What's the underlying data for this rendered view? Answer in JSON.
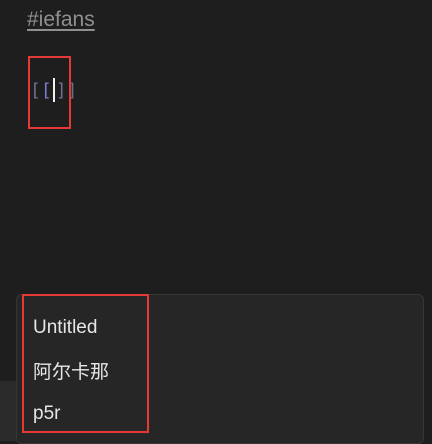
{
  "editor": {
    "tag": "#iefans",
    "brackets": {
      "open": "[[",
      "close": "]]"
    }
  },
  "suggestions": [
    {
      "label": "Untitled"
    },
    {
      "label": "阿尔卡那"
    },
    {
      "label": "p5r"
    }
  ],
  "colors": {
    "background": "#1e1e1e",
    "popup": "#262626",
    "highlight": "#e53935",
    "bracket": "#7b7bd6",
    "tag": "#8f8f8f"
  }
}
